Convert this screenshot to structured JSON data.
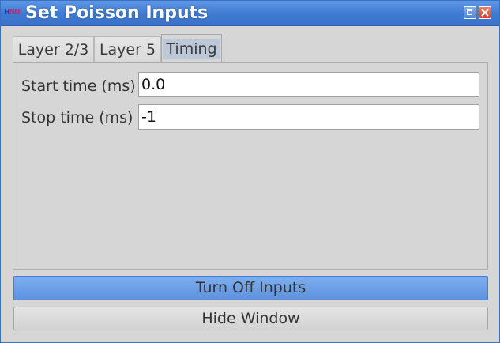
{
  "window": {
    "title": "Set Poisson Inputs",
    "app_icon": {
      "h": "H",
      "rest": "NN"
    }
  },
  "tabs": [
    {
      "label": "Layer 2/3",
      "selected": false
    },
    {
      "label": "Layer 5",
      "selected": false
    },
    {
      "label": "Timing",
      "selected": true
    }
  ],
  "form": {
    "start": {
      "label": "Start time (ms)",
      "value": "0.0"
    },
    "stop": {
      "label": "Stop time (ms)",
      "value": "-1"
    }
  },
  "buttons": {
    "turn_off": "Turn Off Inputs",
    "hide": "Hide Window"
  },
  "colors": {
    "titlebar": "#3f7ad2",
    "primary_button": "#6a9ee6",
    "background": "#d6d6d6"
  }
}
